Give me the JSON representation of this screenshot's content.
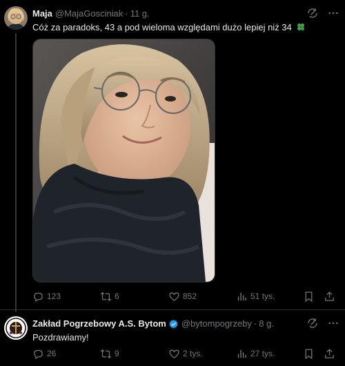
{
  "colors": {
    "background": "#000000",
    "text_primary": "#e7e9ea",
    "text_secondary": "#71767b",
    "divider": "#2f3336",
    "verified_blue": "#1d9bf0",
    "clover_green": "#3fa34d"
  },
  "tweets": [
    {
      "display_name": "Maja",
      "handle": "@MajaGosciniak",
      "separator": "·",
      "time": "11 g.",
      "text": "Cóż za paradoks, 43 a pod wieloma względami dużo lepiej niż 34",
      "emoji": "four-leaf-clover",
      "has_media": true,
      "stats": {
        "replies": "123",
        "reposts": "6",
        "likes": "852",
        "views": "51 tys."
      }
    },
    {
      "display_name": "Zakład Pogrzebowy A.S. Bytom",
      "verified": true,
      "handle": "@bytompogrzeby",
      "separator": "·",
      "time": "8 g.",
      "text": "Pozdrawiamy!",
      "stats": {
        "replies": "26",
        "reposts": "9",
        "likes": "2 tys.",
        "views": "27 tys."
      }
    }
  ],
  "icons": [
    "grok-icon",
    "more-icon",
    "reply-icon",
    "retweet-icon",
    "like-icon",
    "views-icon",
    "bookmark-icon",
    "share-icon",
    "verified-icon"
  ]
}
